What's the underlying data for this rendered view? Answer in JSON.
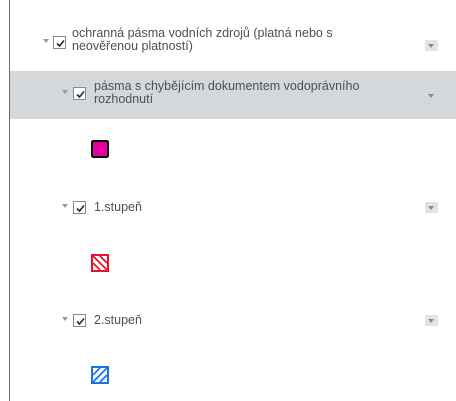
{
  "layers": [
    {
      "label": "ochranná pásma vodních zdrojů (platná nebo s neověřenou platností)",
      "checked": true,
      "caret_icon": "caret-down-icon",
      "menu_icon": "dropdown-icon"
    },
    {
      "label": "pásma s chybějícím dokumentem vodoprávního rozhodnutí",
      "checked": true,
      "selected": true,
      "caret_icon": "caret-down-icon",
      "menu_icon": "dropdown-icon",
      "symbol": {
        "type": "solid",
        "fill": "#e4009c",
        "stroke": "#000000"
      }
    },
    {
      "label": "1.stupeň",
      "checked": true,
      "caret_icon": "caret-down-icon",
      "menu_icon": "dropdown-icon",
      "symbol": {
        "type": "hatched",
        "stroke": "#e8122d"
      }
    },
    {
      "label": "2.stupeň",
      "checked": true,
      "caret_icon": "caret-down-icon",
      "menu_icon": "dropdown-icon",
      "symbol": {
        "type": "hatched",
        "stroke": "#1a73e8"
      }
    }
  ]
}
